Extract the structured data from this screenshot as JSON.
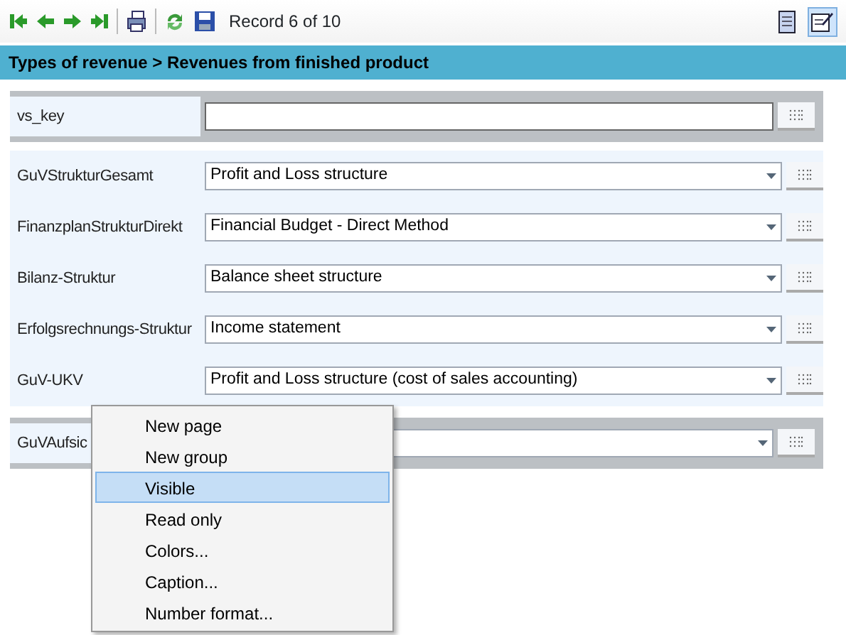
{
  "toolbar": {
    "record": "Record 6 of 10",
    "views": [
      {
        "selected": false
      },
      {
        "selected": true
      }
    ]
  },
  "breadcrumb": "Types of revenue > Revenues from finished product",
  "groups": [
    {
      "kind": "panel",
      "rows": [
        {
          "label": "vs_key",
          "kind": "text"
        }
      ]
    },
    {
      "kind": "plain",
      "rows": [
        {
          "label": "GuVStrukturGesamt",
          "kind": "combo",
          "value": "Profit and Loss structure"
        },
        {
          "label": "FinanzplanStrukturDirekt",
          "kind": "combo",
          "value": "Financial Budget - Direct Method"
        },
        {
          "label": "Bilanz-Struktur",
          "kind": "combo",
          "value": "Balance sheet structure"
        },
        {
          "label": "Erfolgsrechnungs-Struktur",
          "kind": "combo",
          "value": "Income statement"
        },
        {
          "label": "GuV-UKV",
          "kind": "combo",
          "value": "Profit and Loss structure (cost of sales accounting)"
        }
      ]
    },
    {
      "kind": "panel",
      "rows": [
        {
          "label": "GuVAufsic",
          "kind": "combo"
        }
      ]
    }
  ],
  "context_menu": [
    {
      "label": "New page",
      "selected": false
    },
    {
      "label": "New group",
      "selected": false
    },
    {
      "label": "Visible",
      "selected": true
    },
    {
      "label": "Read only",
      "selected": false
    },
    {
      "label": "Colors...",
      "selected": false
    },
    {
      "label": "Caption...",
      "selected": false
    },
    {
      "label": "Number format...",
      "selected": false
    }
  ]
}
